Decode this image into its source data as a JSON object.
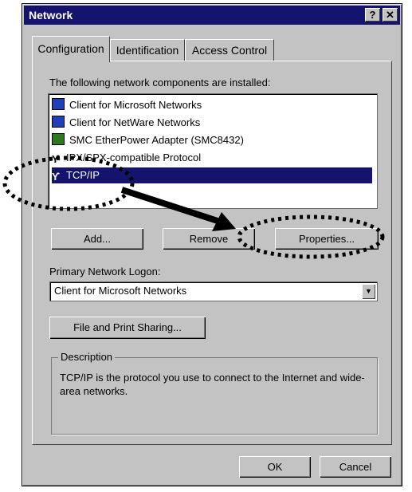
{
  "window": {
    "title": "Network",
    "help_label": "?",
    "close_label": "✕"
  },
  "tabs": [
    {
      "label": "Configuration"
    },
    {
      "label": "Identification"
    },
    {
      "label": "Access Control"
    }
  ],
  "components_label": "The following network components are installed:",
  "components": [
    {
      "label": "Client for Microsoft Networks",
      "icon": "network-client-icon"
    },
    {
      "label": "Client for NetWare Networks",
      "icon": "network-client-icon"
    },
    {
      "label": "SMC EtherPower Adapter (SMC8432)",
      "icon": "network-adapter-icon"
    },
    {
      "label": "IPX/SPX-compatible Protocol",
      "icon": "protocol-icon"
    },
    {
      "label": "TCP/IP",
      "icon": "protocol-icon",
      "selected": true
    }
  ],
  "buttons": {
    "add": "Add...",
    "remove": "Remove",
    "properties": "Properties...",
    "file_print": "File and Print Sharing...",
    "ok": "OK",
    "cancel": "Cancel"
  },
  "logon": {
    "label": "Primary Network Logon:",
    "value": "Client for Microsoft Networks"
  },
  "description": {
    "title": "Description",
    "text": "TCP/IP is the protocol you use to connect to the Internet and wide-area networks."
  },
  "colors": {
    "selection": "#14146e",
    "face": "#c3c3c3",
    "annotation": "#000000"
  }
}
